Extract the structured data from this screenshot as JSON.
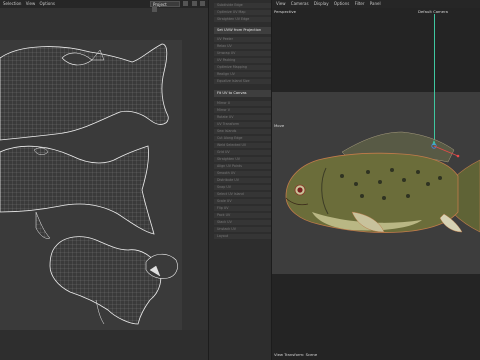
{
  "uv_editor": {
    "menu": [
      "Selection",
      "View",
      "Options"
    ],
    "projection_select": "Project"
  },
  "commands": {
    "items": [
      {
        "label": "Subdivide Edge",
        "active": false
      },
      {
        "label": "Optimize UV Map",
        "active": false
      },
      {
        "label": "Straighten UV Edge",
        "active": false
      },
      {
        "label": "Set UVW from Projection",
        "active": true,
        "gear": true
      },
      {
        "label": "UV Peeler",
        "active": false
      },
      {
        "label": "Relax UV",
        "active": false
      },
      {
        "label": "Unwrap UV",
        "active": false
      },
      {
        "label": "UV Packing",
        "active": false
      },
      {
        "label": "Optimize Mapping",
        "active": false
      },
      {
        "label": "Realign UV",
        "active": false
      },
      {
        "label": "Equalize Island Size",
        "active": false
      },
      {
        "label": "Fit UV to Canvas",
        "active": true
      },
      {
        "label": "Mirror U",
        "active": false
      },
      {
        "label": "Mirror V",
        "active": false
      },
      {
        "label": "Rotate UV",
        "active": false
      },
      {
        "label": "UV Transform",
        "active": false
      },
      {
        "label": "Sew Islands",
        "active": false
      },
      {
        "label": "Cut Along Edge",
        "active": false
      },
      {
        "label": "Weld Selected UV",
        "active": false
      },
      {
        "label": "Grid UV",
        "active": false
      },
      {
        "label": "Straighten UV",
        "active": false
      },
      {
        "label": "Align UV Points",
        "active": false
      },
      {
        "label": "Smooth UV",
        "active": false
      },
      {
        "label": "Distribute UV",
        "active": false
      },
      {
        "label": "Snap UV",
        "active": false
      },
      {
        "label": "Select UV Island",
        "active": false
      },
      {
        "label": "Scale UV",
        "active": false
      },
      {
        "label": "Flip UV",
        "active": false
      },
      {
        "label": "Pack UV",
        "active": false
      },
      {
        "label": "Stack UV",
        "active": false
      },
      {
        "label": "Unstack UV",
        "active": false
      },
      {
        "label": "Layout",
        "active": false
      }
    ]
  },
  "viewport": {
    "menu": [
      "View",
      "Cameras",
      "Display",
      "Options",
      "Filter",
      "Panel"
    ],
    "view_name": "Perspective",
    "camera_label": "Default Camera",
    "mode_label": "Move",
    "footer_label": "View Transform: Scene"
  },
  "colors": {
    "accent_teal": "#3fc7a0",
    "uv_wire": "#e8e8e8",
    "fish_body": "#6b6d3a"
  }
}
